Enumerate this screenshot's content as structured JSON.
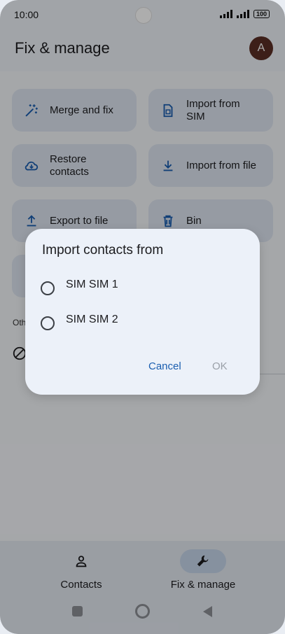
{
  "status_bar": {
    "time": "10:00",
    "battery": "100"
  },
  "header": {
    "title": "Fix & manage",
    "avatar_initial": "A"
  },
  "tiles": [
    {
      "label": "Merge and fix",
      "icon": "magic-wand-icon"
    },
    {
      "label": "Import from SIM",
      "icon": "sim-card-icon"
    },
    {
      "label": "Restore contacts",
      "icon": "cloud-download-icon"
    },
    {
      "label": "Import from file",
      "icon": "download-icon"
    },
    {
      "label": "Export to file",
      "icon": "upload-icon"
    },
    {
      "label": "Bin",
      "icon": "trash-icon"
    }
  ],
  "other_section_label": "Oth",
  "dialog": {
    "title": "Import contacts from",
    "options": [
      "SIM SIM 1",
      "SIM SIM 2"
    ],
    "cancel_label": "Cancel",
    "ok_label": "OK"
  },
  "bottom_nav": {
    "items": [
      {
        "label": "Contacts",
        "icon": "person-icon",
        "selected": false
      },
      {
        "label": "Fix & manage",
        "icon": "wrench-icon",
        "selected": true
      }
    ]
  },
  "colors": {
    "accent": "#1a5eb0",
    "selected_pill": "#c6d6ea",
    "avatar": "#5b2f25"
  }
}
